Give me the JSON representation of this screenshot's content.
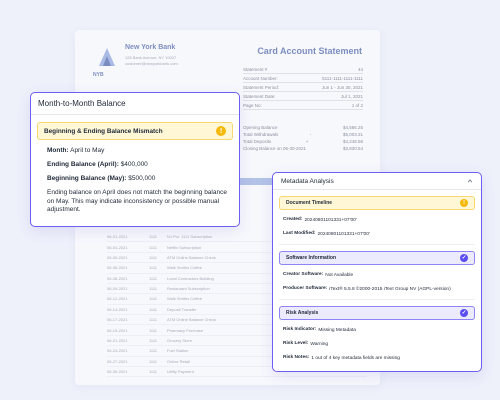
{
  "statement": {
    "logo_text": "NYB",
    "bank_name": "New York Bank",
    "address_lines": [
      "125 Bank Avenue, NY 10007",
      "customer@newyorkbank.com"
    ],
    "title": "Card Account Statement",
    "meta_rows": [
      {
        "label": "Statement #",
        "value": "44"
      },
      {
        "label": "Account Number:",
        "value": "5111-1111-1111-1111"
      },
      {
        "label": "Statement Period:",
        "value": "Jun 1 - Jun 30, 2021"
      },
      {
        "label": "Statement Date:",
        "value": "Jul 1, 2021"
      },
      {
        "label": "Page No:",
        "value": "1 of 2"
      }
    ],
    "summary_rows": [
      {
        "label": "Opening Balance",
        "sign": "",
        "value": "$4,586.25"
      },
      {
        "label": "Total Withdrawals",
        "sign": "-",
        "value": "$5,003.31"
      },
      {
        "label": "Total Deposits",
        "sign": "+",
        "value": "$4,248.58"
      },
      {
        "label": "Closing Balance on 06-30-2021",
        "sign": "",
        "value": "$3,830.54"
      }
    ],
    "transactions": [
      {
        "date": "06-01-2021",
        "code": "1111",
        "desc": "NJ Pur. 1111 Subscription"
      },
      {
        "date": "06-04-2021",
        "code": "1111",
        "desc": "Netflix Subscription"
      },
      {
        "date": "06-05-2021",
        "code": "1111",
        "desc": "ATM Online Balance Check"
      },
      {
        "date": "06-06-2021",
        "code": "1111",
        "desc": "Walk Smiths Coffee"
      },
      {
        "date": "06-08-2021",
        "code": "1111",
        "desc": "Local Contractors Building"
      },
      {
        "date": "06-09-2021",
        "code": "1111",
        "desc": "Restaurant Subscription"
      },
      {
        "date": "06-12-2021",
        "code": "1111",
        "desc": "Walk Smiths Coffee"
      },
      {
        "date": "06-14-2021",
        "code": "1111",
        "desc": "Deposit Transfer"
      },
      {
        "date": "06-17-2021",
        "code": "1111",
        "desc": "ATM Online Balance Check"
      },
      {
        "date": "06-19-2021",
        "code": "1111",
        "desc": "Pharmacy Purchase"
      },
      {
        "date": "06-21-2021",
        "code": "1111",
        "desc": "Grocery Store"
      },
      {
        "date": "06-24-2021",
        "code": "1111",
        "desc": "Fuel Station"
      },
      {
        "date": "06-27-2021",
        "code": "1111",
        "desc": "Online Retail"
      },
      {
        "date": "06-30-2021",
        "code": "1111",
        "desc": "Utility Payment"
      }
    ]
  },
  "month_card": {
    "header": "Month-to-Month Balance",
    "alert_title": "Beginning & Ending Balance Mismatch",
    "alert_icon": "warning-icon",
    "month_label": "Month:",
    "month_value": "April to May",
    "end_label": "Ending Balance (April):",
    "end_value": "$400,000",
    "begin_label": "Beginning Balance (May):",
    "begin_value": "$500,000",
    "note": "Ending balance on April does not match the beginning balance on May. This may indicate inconsistency or possible manual adjustment."
  },
  "metadata_card": {
    "header": "Metadata Analysis",
    "timeline": {
      "title": "Document Timeline",
      "created_label": "Created:",
      "created_value": "20240801101331+07'00'",
      "modified_label": "Last Modified:",
      "modified_value": "20240801101331+07'00'"
    },
    "software": {
      "title": "Software Information",
      "creator_label": "Creator Software:",
      "creator_value": "Not Available",
      "producer_label": "Producer Software:",
      "producer_value": "iText® 5.5.8 ©2000-2015 iText Group NV (AGPL-version)"
    },
    "risk": {
      "title": "Risk Analysis",
      "indicator_label": "Risk Indicator:",
      "indicator_value": "Missing Metadata",
      "level_label": "Risk Level:",
      "level_value": "Warning",
      "notes_label": "Risk Notes:",
      "notes_value": "1 out of 4 key metadata fields are missing"
    }
  },
  "colors": {
    "accent": "#6d5ff2",
    "warning": "#f5b90b",
    "warning_bg": "#fff7d6",
    "info_bg": "#eceafd",
    "bank_blue": "#1f3d8f"
  }
}
